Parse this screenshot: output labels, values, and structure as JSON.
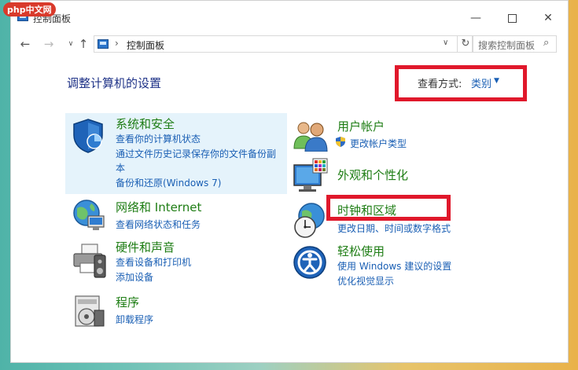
{
  "watermark": {
    "text": "php中文网"
  },
  "window": {
    "title": "控制面板",
    "controls": {
      "minimize": "—",
      "close": "✕"
    }
  },
  "nav": {
    "back": "←",
    "forward": "→",
    "recent": "∨",
    "up": "↑",
    "address_separator": "›",
    "address": "控制面板",
    "address_dropdown": "∨",
    "refresh": "↻",
    "search_placeholder": "搜索控制面板",
    "search_icon": "⌕"
  },
  "header": {
    "title": "调整计算机的设置",
    "view_label": "查看方式:",
    "view_value": "类别",
    "view_caret": "▼"
  },
  "categories": {
    "system_security": {
      "title": "系统和安全",
      "icon": "shield-icon",
      "links": [
        "查看你的计算机状态",
        "通过文件历史记录保存你的文件备份副",
        "本",
        "备份和还原(Windows 7)"
      ]
    },
    "network": {
      "title": "网络和 Internet",
      "icon": "network-globe-icon",
      "links": [
        "查看网络状态和任务"
      ]
    },
    "hardware": {
      "title": "硬件和声音",
      "icon": "printer-icon",
      "links": [
        "查看设备和打印机",
        "添加设备"
      ]
    },
    "programs": {
      "title": "程序",
      "icon": "programs-icon",
      "links": [
        "卸载程序"
      ]
    },
    "user_accounts": {
      "title": "用户帐户",
      "icon": "users-icon",
      "links": [
        "更改帐户类型"
      ]
    },
    "appearance": {
      "title": "外观和个性化",
      "icon": "monitor-icon",
      "links": []
    },
    "clock_region": {
      "title": "时钟和区域",
      "icon": "clock-globe-icon",
      "links": [
        "更改日期、时间或数字格式"
      ]
    },
    "ease_access": {
      "title": "轻松使用",
      "icon": "ease-of-access-icon",
      "links": [
        "使用 Windows 建议的设置",
        "优化视觉显示"
      ]
    }
  },
  "colors": {
    "category_title": "#1e7d14",
    "link": "#1a5fb4",
    "page_title": "#1e3287",
    "highlight": "#e5f3fb",
    "annotation_box": "#e0182b"
  }
}
